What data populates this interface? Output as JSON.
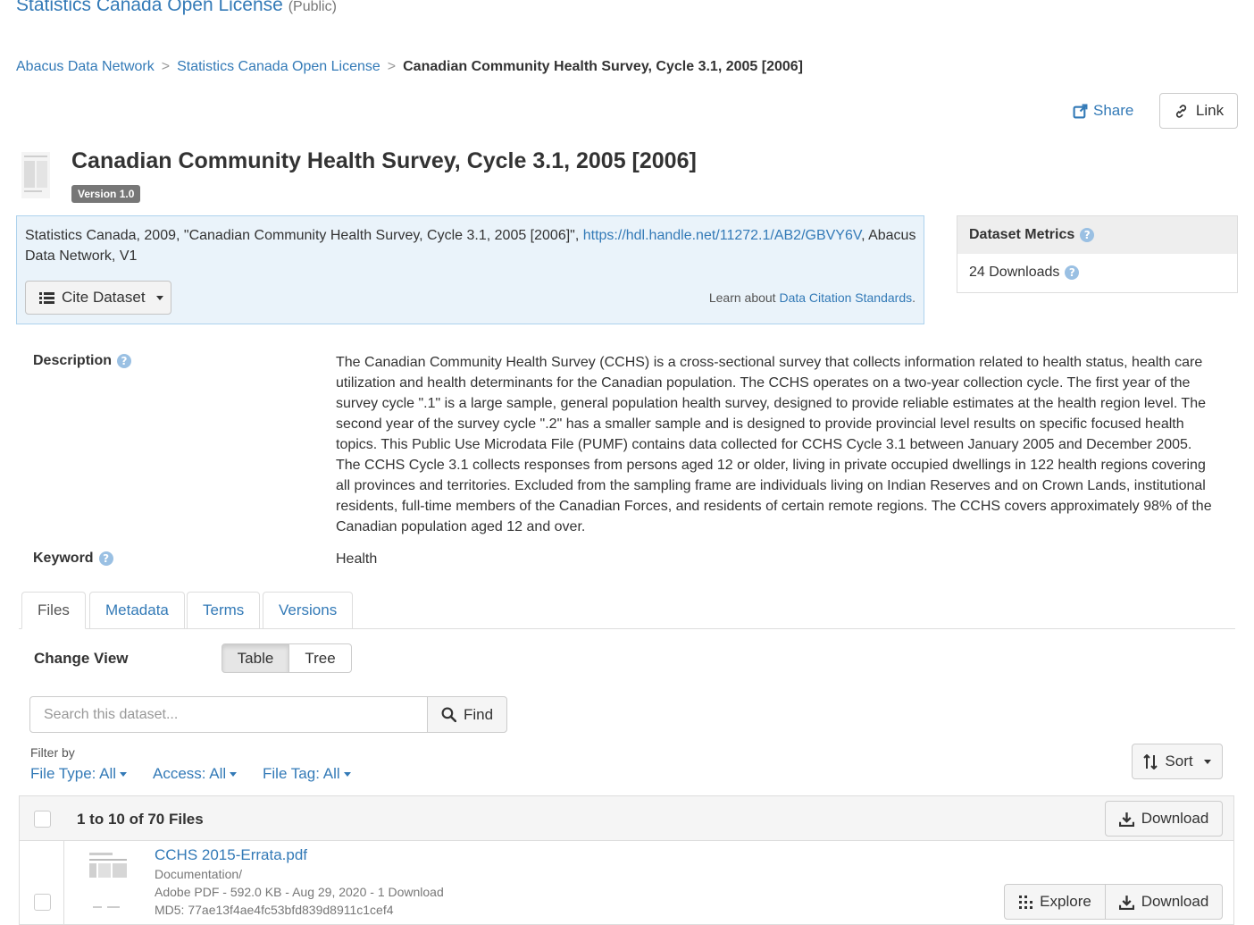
{
  "header": {
    "dataverse_title": "Statistics Canada Open License",
    "dataverse_status": "(Public)"
  },
  "breadcrumb": {
    "items": [
      "Abacus Data Network",
      "Statistics Canada Open License"
    ],
    "separator": ">",
    "current": "Canadian Community Health Survey, Cycle 3.1, 2005 [2006]"
  },
  "actions": {
    "share_label": "Share",
    "link_label": "Link"
  },
  "dataset": {
    "title": "Canadian Community Health Survey, Cycle 3.1, 2005 [2006]",
    "version": "Version 1.0"
  },
  "citation": {
    "text_before": "Statistics Canada, 2009, \"Canadian Community Health Survey, Cycle 3.1, 2005 [2006]\", ",
    "doi_link": "https://hdl.handle.net/11272.1/AB2/GBVY6V",
    "text_after": ", Abacus Data Network, V1",
    "cite_button": "Cite Dataset",
    "learn_prefix": "Learn about",
    "learn_link": "Data Citation Standards",
    "learn_suffix": "."
  },
  "metrics": {
    "heading": "Dataset Metrics",
    "downloads": "24 Downloads"
  },
  "metadata": {
    "description_label": "Description",
    "description": "The Canadian Community Health Survey (CCHS) is a cross-sectional survey that collects information related to health status, health care utilization and health determinants for the Canadian population. The CCHS operates on a two-year collection cycle. The first year of the survey cycle \".1\" is a large sample, general population health survey, designed to provide reliable estimates at the health region level. The second year of the survey cycle \".2\" has a smaller sample and is designed to provide provincial level results on specific focused health topics. This Public Use Microdata File (PUMF) contains data collected for CCHS Cycle 3.1 between January 2005 and December 2005. The CCHS Cycle 3.1 collects responses from persons aged 12 or older, living in private occupied dwellings in 122 health regions covering all provinces and territories. Excluded from the sampling frame are individuals living on Indian Reserves and on Crown Lands, institutional residents, full-time members of the Canadian Forces, and residents of certain remote regions. The CCHS covers approximately 98% of the Canadian population aged 12 and over.",
    "keyword_label": "Keyword",
    "keyword": "Health"
  },
  "tabs": [
    "Files",
    "Metadata",
    "Terms",
    "Versions"
  ],
  "files_panel": {
    "change_view_label": "Change View",
    "view_table": "Table",
    "view_tree": "Tree",
    "search_placeholder": "Search this dataset...",
    "find_label": "Find",
    "filter_by": "Filter by",
    "filter_file_type": "File Type: All",
    "filter_access": "Access: All",
    "filter_file_tag": "File Tag: All",
    "sort_label": "Sort",
    "count_label": "1 to 10 of 70 Files",
    "download_label": "Download"
  },
  "files": [
    {
      "name": "CCHS 2015-Errata.pdf",
      "folder": "Documentation/",
      "info": "Adobe PDF - 592.0 KB - Aug 29, 2020 - 1 Download",
      "md5": "MD5: 77ae13f4ae4fc53bfd839d8911c1cef4",
      "explore_label": "Explore",
      "download_label": "Download"
    }
  ],
  "colors": {
    "link": "#337ab7",
    "citation_bg": "#eaf3fa",
    "citation_border": "#add2ed",
    "version_badge": "#777777"
  }
}
